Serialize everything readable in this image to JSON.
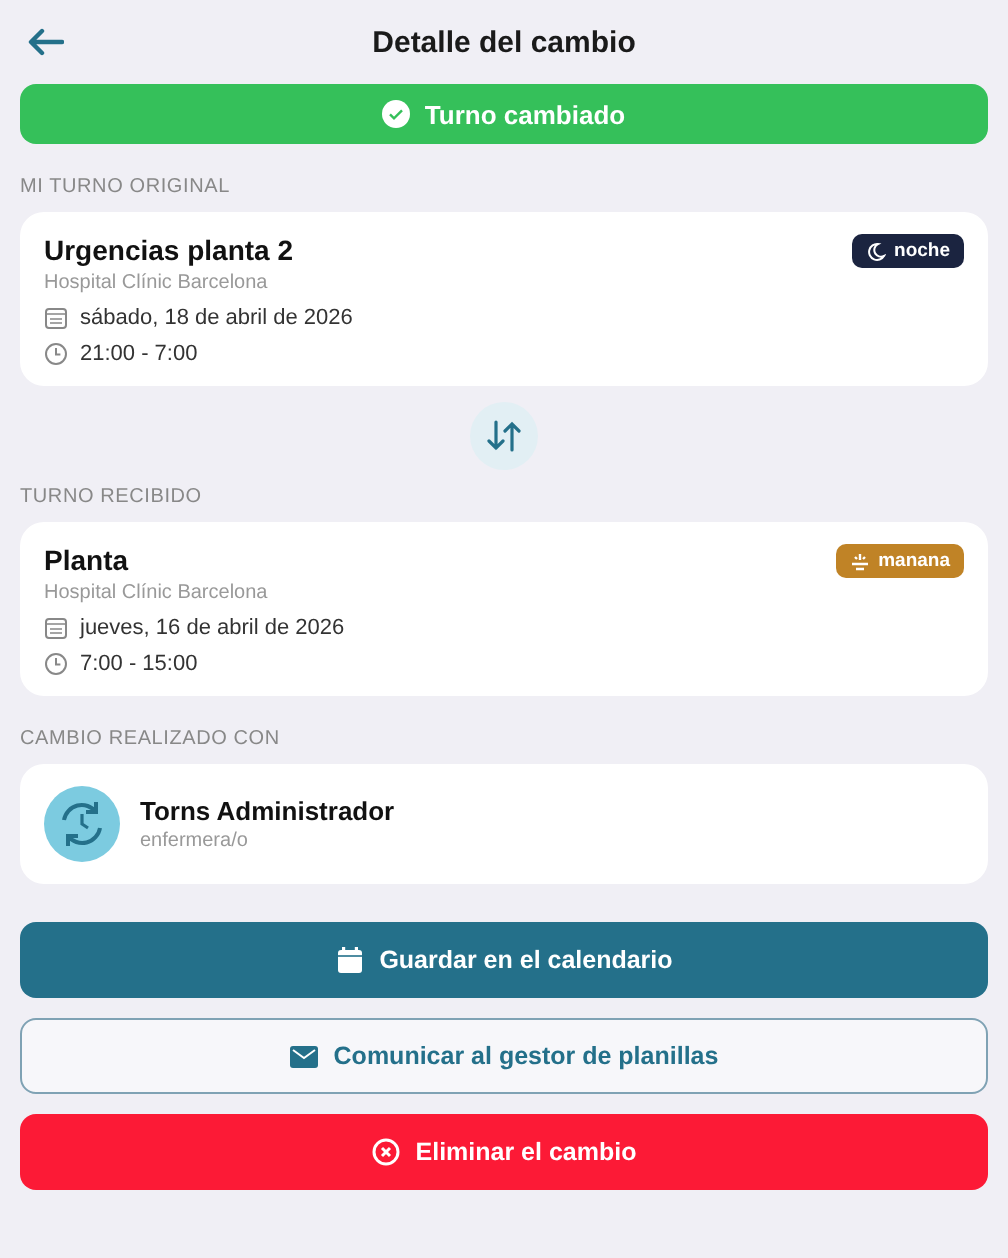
{
  "header": {
    "title": "Detalle del cambio"
  },
  "status": {
    "text": "Turno cambiado"
  },
  "sections": [
    {
      "label": "MI TURNO ORIGINAL",
      "name": "Urgencias planta 2",
      "place": "Hospital Clínic Barcelona",
      "date": "sábado, 18 de abril de 2026",
      "time": "21:00 - 7:00",
      "badge": {
        "kind": "night",
        "text": "noche",
        "color": "#1b2440"
      }
    },
    {
      "label": "TURNO RECIBIDO",
      "name": "Planta",
      "place": "Hospital Clínic Barcelona",
      "date": "jueves, 16 de abril de 2026",
      "time": "7:00 - 15:00",
      "badge": {
        "kind": "morning",
        "text": "manana",
        "color": "#c08326"
      }
    }
  ],
  "partner": {
    "label": "CAMBIO REALIZADO CON",
    "name": "Torns Administrador",
    "role": "enfermera/o"
  },
  "buttons": [
    {
      "kind": "primary",
      "label": "Guardar en el calendario"
    },
    {
      "kind": "outline",
      "label": "Comunicar al gestor de planillas"
    },
    {
      "kind": "danger",
      "label": "Eliminar el cambio"
    }
  ]
}
